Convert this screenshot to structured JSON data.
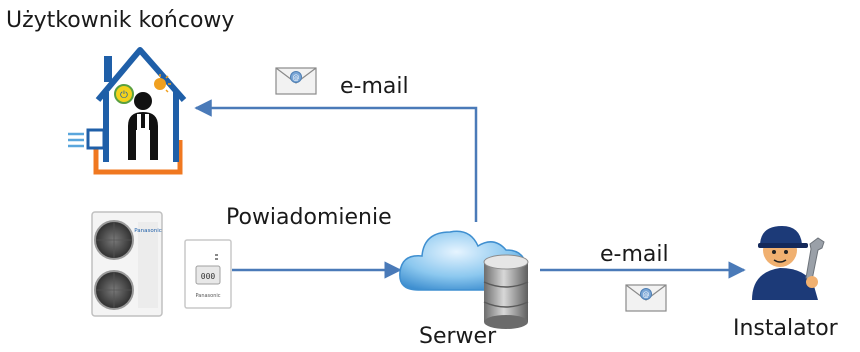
{
  "diagram": {
    "end_user_label": "Użytkownik końcowy",
    "email_top_label": "e-mail",
    "notification_label": "Powiadomienie",
    "email_bottom_label": "e-mail",
    "server_label": "Serwer",
    "installer_label": "Instalator",
    "unit_brand": "Panasonic",
    "controller_brand": "Panasonic",
    "colors": {
      "arrow": "#4a7ab8",
      "house": "#1f5fa8",
      "house_orange": "#f07820",
      "cloud": "#5aa6dc",
      "database": "#8c8c8c",
      "installer": "#1c3a78"
    }
  }
}
